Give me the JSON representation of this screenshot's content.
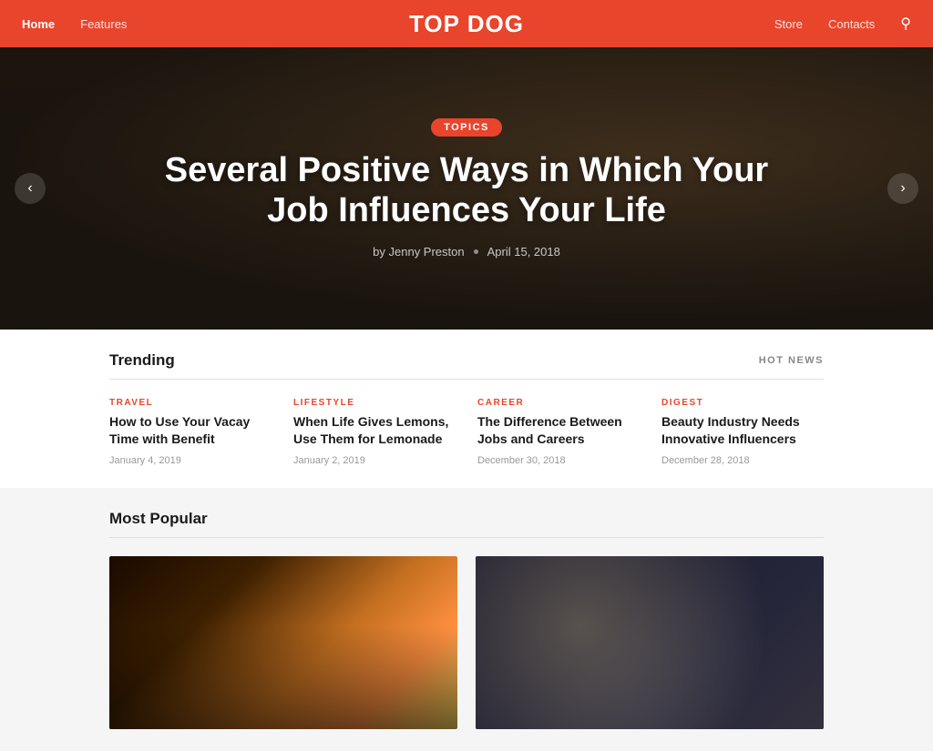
{
  "site": {
    "title": "TOP DOG"
  },
  "nav": {
    "links": [
      {
        "label": "Home",
        "active": true
      },
      {
        "label": "Features",
        "active": false
      },
      {
        "label": "Store",
        "active": false
      },
      {
        "label": "Contacts",
        "active": false
      }
    ]
  },
  "hero": {
    "badge": "TOPICS",
    "title": "Several Positive Ways in Which Your Job Influences Your Life",
    "author": "by Jenny Preston",
    "date": "April 15, 2018",
    "arrow_left": "‹",
    "arrow_right": "›"
  },
  "trending": {
    "section_title": "Trending",
    "hot_news": "HOT NEWS",
    "items": [
      {
        "category": "TRAVEL",
        "title": "How to Use Your Vacay Time with Benefit",
        "date": "January 4, 2019"
      },
      {
        "category": "LIFESTYLE",
        "title": "When Life Gives Lemons, Use Them for Lemonade",
        "date": "January 2, 2019"
      },
      {
        "category": "CAREER",
        "title": "The Difference Between Jobs and Careers",
        "date": "December 30, 2018"
      },
      {
        "category": "DIGEST",
        "title": "Beauty Industry Needs Innovative Influencers",
        "date": "December 28, 2018"
      }
    ]
  },
  "most_popular": {
    "section_title": "Most Popular",
    "cards": [
      {
        "label": "night-city-card"
      },
      {
        "label": "office-meeting-card"
      }
    ]
  },
  "icons": {
    "search": "🔍",
    "arrow_left": "❮",
    "arrow_right": "❯"
  }
}
